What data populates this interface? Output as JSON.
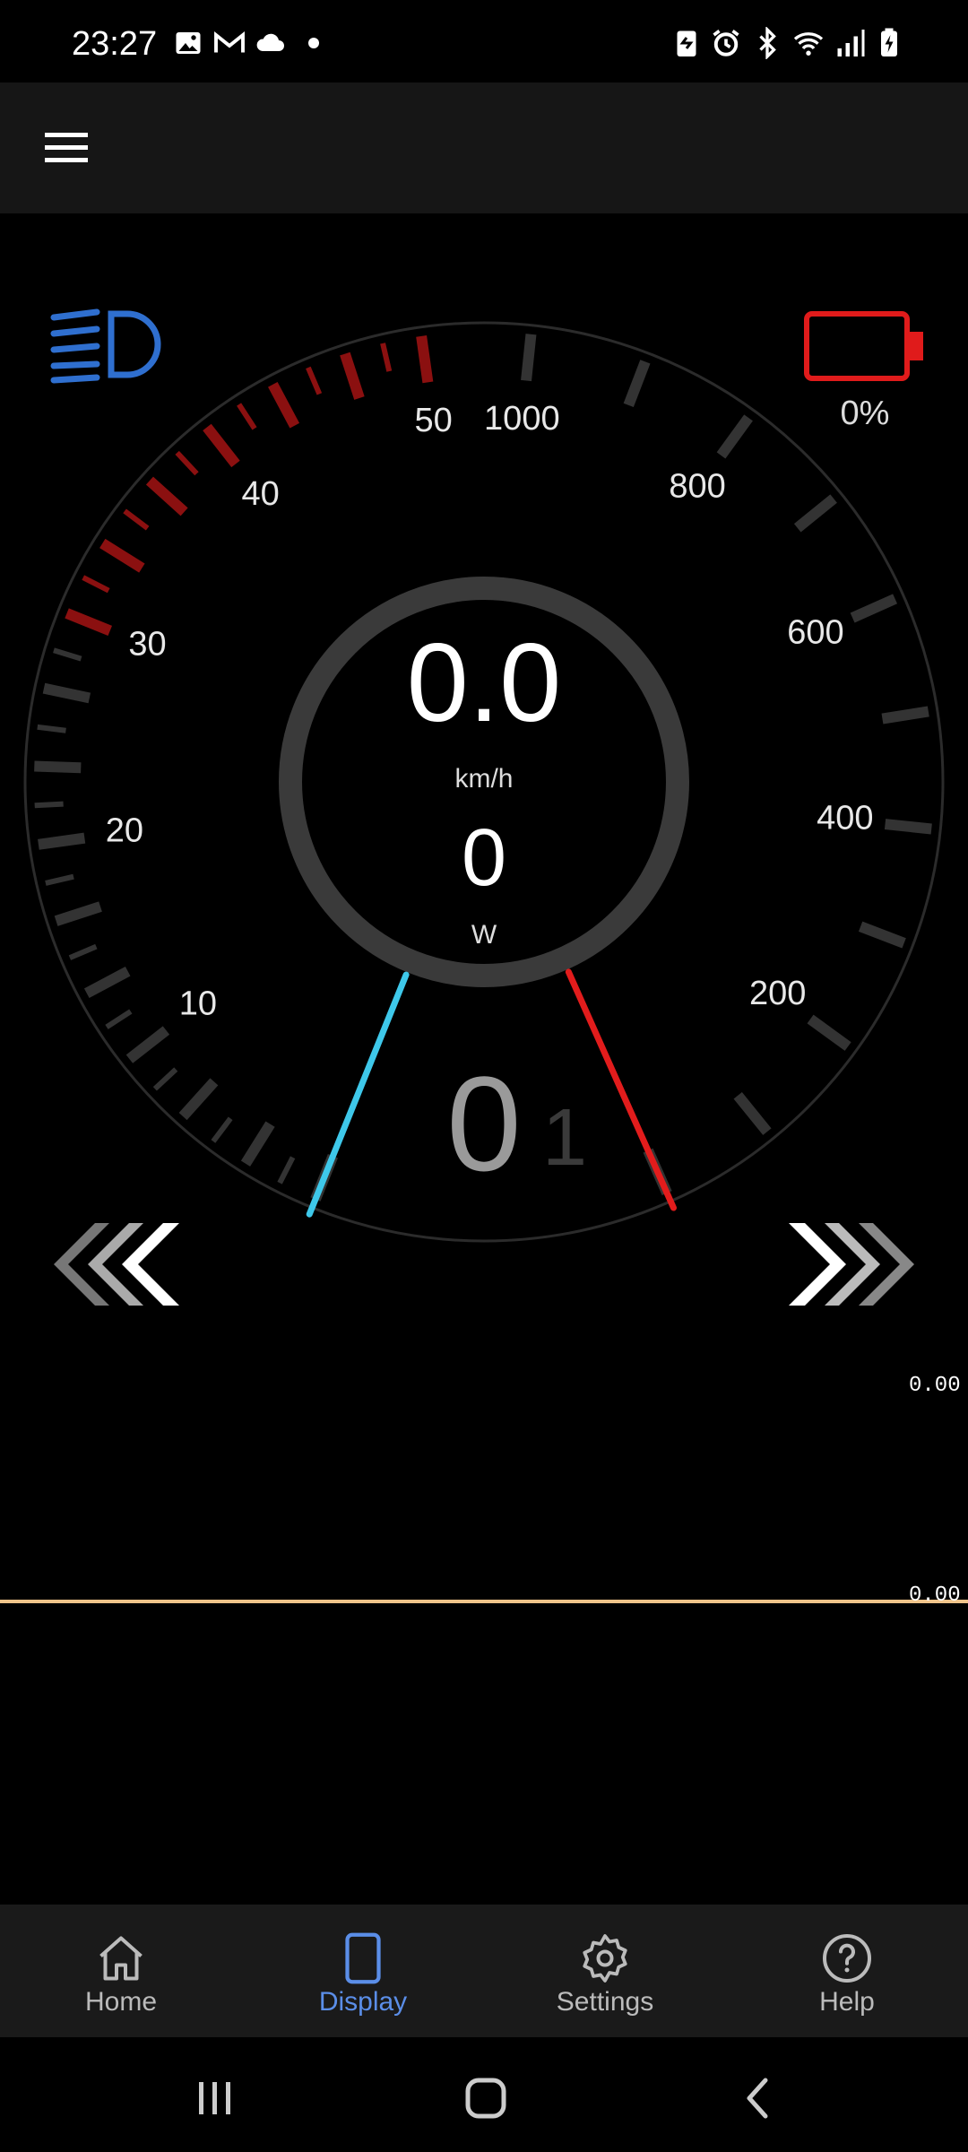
{
  "status_bar": {
    "time": "23:27",
    "left_icons": [
      "image-icon",
      "gmail-icon",
      "cloud-icon",
      "dot-icon"
    ],
    "right_icons": [
      "battery-saver-icon",
      "alarm-icon",
      "bluetooth-icon",
      "wifi-icon",
      "signal-icon",
      "battery-charging-icon"
    ]
  },
  "app_bar": {
    "menu_icon": "hamburger-menu-icon"
  },
  "dashboard": {
    "headlight_icon": "headlight-icon",
    "battery": {
      "icon": "battery-icon",
      "percent_label": "0%",
      "level": 0,
      "color": "#e01b1b"
    },
    "speed": {
      "value": "0.0",
      "unit": "km/h",
      "scale_labels": [
        "10",
        "20",
        "30",
        "40",
        "50"
      ],
      "needle_value": 0,
      "needle_color": "#3ec8ea"
    },
    "power": {
      "value": "0",
      "unit": "W",
      "scale_labels": [
        "200",
        "400",
        "600",
        "800",
        "1000"
      ],
      "needle_value": 0,
      "needle_color": "#e21c1c"
    },
    "gear": {
      "current": "0",
      "next": "1"
    },
    "gear_buttons": {
      "previous": "chevrons-left-icon",
      "next": "chevrons-right-icon"
    }
  },
  "graph": {
    "max_label": "0.00",
    "min_label": "0.00",
    "line_color": "#f0c48a"
  },
  "bottom_nav": {
    "items": [
      {
        "label": "Home",
        "icon": "home-icon",
        "active": false
      },
      {
        "label": "Display",
        "icon": "phone-icon",
        "active": true
      },
      {
        "label": "Settings",
        "icon": "gear-icon",
        "active": false
      },
      {
        "label": "Help",
        "icon": "help-circle-icon",
        "active": false
      }
    ],
    "active_color": "#5b8ee8"
  },
  "system_nav": {
    "buttons": [
      "recents-icon",
      "home-circle-icon",
      "back-icon"
    ]
  }
}
